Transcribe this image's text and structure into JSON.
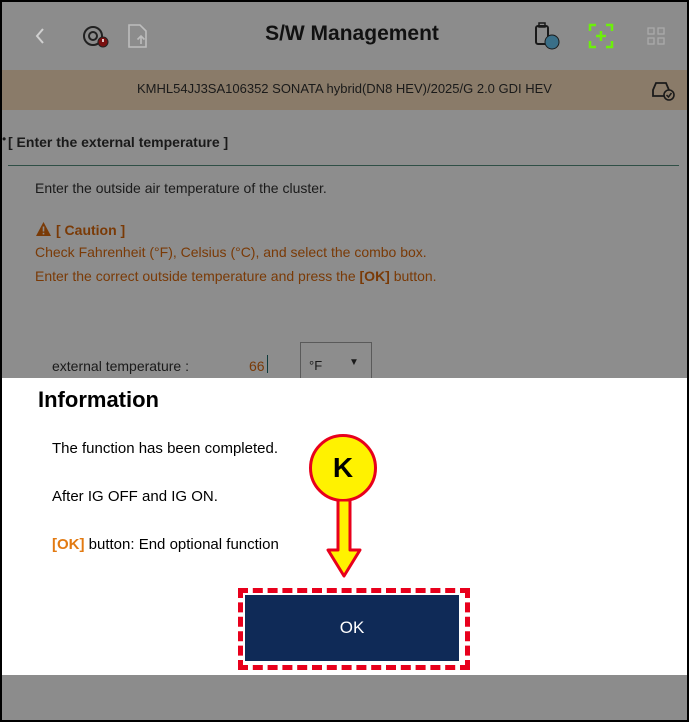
{
  "header": {
    "title": "S/W Management",
    "back_icon": "chevron-left-icon",
    "icons": [
      "diagnostic-timer-icon",
      "upload-file-icon",
      "vci-icon",
      "screen-capture-icon",
      "grid-icon"
    ]
  },
  "vehicle": {
    "info": "KMHL54JJ3SA106352  SONATA hybrid(DN8 HEV)/2025/G 2.0 GDI HEV"
  },
  "section": {
    "title": "[ Enter the external temperature ]",
    "instruction": "Enter the outside air temperature of the cluster.",
    "caution_title": "[ Caution ]",
    "caution_line1": "Check Fahrenheit (°F), Celsius (°C), and select the combo box.",
    "caution_line2_pre": "Enter the correct outside temperature and press the ",
    "caution_line2_ok": "[OK]",
    "caution_line2_post": " button."
  },
  "temperature": {
    "label": "external temperature :",
    "value": "66",
    "unit": "°F"
  },
  "dialog": {
    "title": "Information",
    "line1": "The function has been completed.",
    "line2": "After IG OFF and IG ON.",
    "line3_ok": "[OK]",
    "line3_rest": " button: End optional function",
    "ok_button": "OK"
  },
  "callout": {
    "letter": "K"
  },
  "colors": {
    "caution": "#7a3a06",
    "ok_orange": "#e27a12",
    "button_navy": "#0f2a57",
    "highlight_red": "#e8001c",
    "callout_yellow": "#fff200"
  }
}
